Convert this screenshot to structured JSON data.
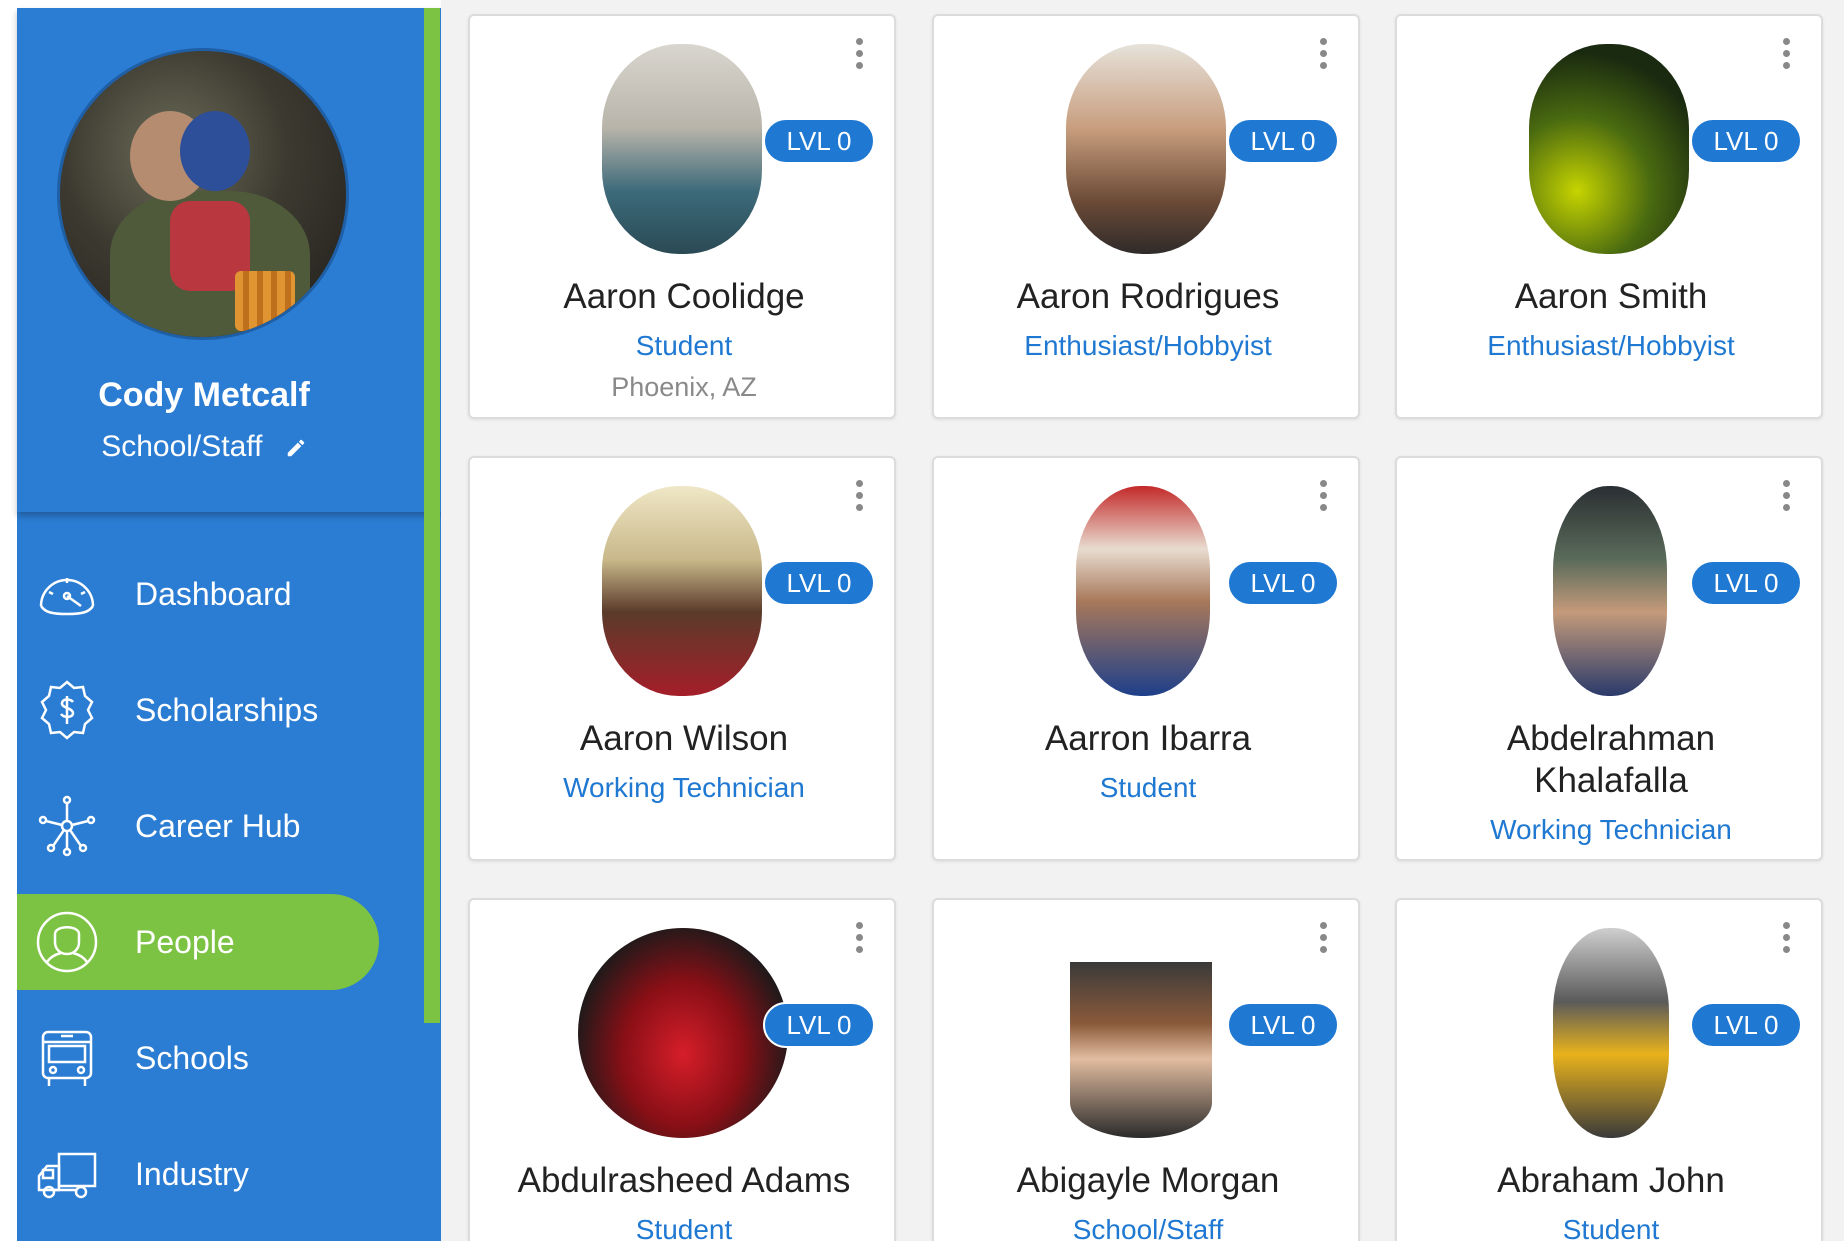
{
  "sidebar": {
    "profile": {
      "name": "Cody Metcalf",
      "role": "School/Staff"
    },
    "nav": [
      {
        "label": "Dashboard",
        "icon": "speedometer-icon",
        "active": false
      },
      {
        "label": "Scholarships",
        "icon": "dollar-badge-icon",
        "active": false
      },
      {
        "label": "Career Hub",
        "icon": "network-hub-icon",
        "active": false
      },
      {
        "label": "People",
        "icon": "person-icon",
        "active": true
      },
      {
        "label": "Schools",
        "icon": "bus-icon",
        "active": false
      },
      {
        "label": "Industry",
        "icon": "truck-icon",
        "active": false
      }
    ],
    "accent_color": "#2b7cd3",
    "active_color": "#7cc243"
  },
  "people": [
    {
      "name": "Aaron Coolidge",
      "role": "Student",
      "location": "Phoenix, AZ",
      "level": "LVL 0"
    },
    {
      "name": "Aaron Rodrigues",
      "role": "Enthusiast/Hobbyist",
      "level": "LVL 0"
    },
    {
      "name": "Aaron Smith",
      "role": "Enthusiast/Hobbyist",
      "level": "LVL 0"
    },
    {
      "name": "Aaron Wilson",
      "role": "Working Technician",
      "level": "LVL 0"
    },
    {
      "name": "Aarron Ibarra",
      "role": "Student",
      "level": "LVL 0"
    },
    {
      "name": "Abdelrahman Khalafalla",
      "role": "Working Technician",
      "level": "LVL 0"
    },
    {
      "name": "Abdulrasheed Adams",
      "role": "Student",
      "level": "LVL 0"
    },
    {
      "name": "Abigayle Morgan",
      "role": "School/Staff",
      "level": "LVL 0"
    },
    {
      "name": "Abraham John",
      "role": "Student",
      "level": "LVL 0"
    }
  ]
}
